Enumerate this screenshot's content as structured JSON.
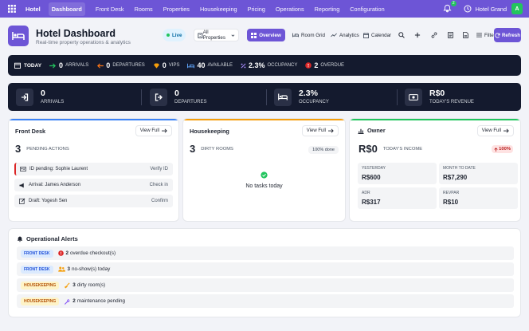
{
  "nav": {
    "brand": "Hotel",
    "items": [
      "Dashboard",
      "Front Desk",
      "Rooms",
      "Properties",
      "Housekeeping",
      "Pricing",
      "Operations",
      "Reporting",
      "Configuration"
    ],
    "notif_count": "2",
    "account": "Hotel Grand",
    "avatar": "A"
  },
  "header": {
    "title": "Hotel Dashboard",
    "subtitle": "Real-time property operations & analytics",
    "live": "Live",
    "property_select": "All Properties",
    "overview": "Overview",
    "room_grid": "Room Grid",
    "analytics": "Analytics",
    "calendar": "Calendar",
    "filters": "Filters",
    "refresh": "Refresh"
  },
  "today_bar": {
    "label": "TODAY",
    "arrivals": {
      "value": "0",
      "label": "ARRIVALS"
    },
    "departures": {
      "value": "0",
      "label": "DEPARTURES"
    },
    "vips": {
      "value": "0",
      "label": "VIPS"
    },
    "available": {
      "value": "40",
      "label": "AVAILABLE"
    },
    "occupancy": {
      "value": "2.3%",
      "label": "OCCUPANCY"
    },
    "overdue": {
      "value": "2",
      "label": "OVERDUE"
    }
  },
  "kpis": [
    {
      "value": "0",
      "label": "ARRIVALS"
    },
    {
      "value": "0",
      "label": "DEPARTURES"
    },
    {
      "value": "2.3%",
      "label": "OCCUPANCY"
    },
    {
      "value": "R$0",
      "label": "TODAY'S REVENUE"
    }
  ],
  "front_desk": {
    "title": "Front Desk",
    "view_full": "View Full",
    "count": "3",
    "count_label": "PENDING ACTIONS",
    "rows": [
      {
        "text": "ID pending: Sophie Laurent",
        "action": "Verify ID"
      },
      {
        "text": "Arrival: James Anderson",
        "action": "Check in"
      },
      {
        "text": "Draft: Yogesh Sen",
        "action": "Confirm"
      }
    ]
  },
  "housekeeping": {
    "title": "Housekeeping",
    "view_full": "View Full",
    "count": "3",
    "count_label": "DIRTY ROOMS",
    "done": "100% done",
    "empty": "No tasks today"
  },
  "owner": {
    "title": "Owner",
    "view_full": "View Full",
    "income": "R$0",
    "income_label": "TODAY'S INCOME",
    "change": "100%",
    "cells": [
      {
        "label": "YESTERDAY",
        "value": "R$600"
      },
      {
        "label": "MONTH TO DATE",
        "value": "R$7,290"
      },
      {
        "label": "ADR",
        "value": "R$317"
      },
      {
        "label": "REVPAR",
        "value": "R$10"
      }
    ]
  },
  "alerts": {
    "title": "Operational Alerts",
    "rows": [
      {
        "tag": "FRONT DESK",
        "count": "2",
        "text": "overdue checkout(s)"
      },
      {
        "tag": "FRONT DESK",
        "count": "3",
        "text": "no-show(s) today"
      },
      {
        "tag": "HOUSEKEEPING",
        "count": "3",
        "text": "dirty room(s)"
      },
      {
        "tag": "HOUSEKEEPING",
        "count": "2",
        "text": "maintenance pending"
      }
    ]
  },
  "colors": {
    "brand": "#6d55d6",
    "dark": "#141a2e",
    "success": "#22c55e",
    "danger": "#dc2626"
  }
}
